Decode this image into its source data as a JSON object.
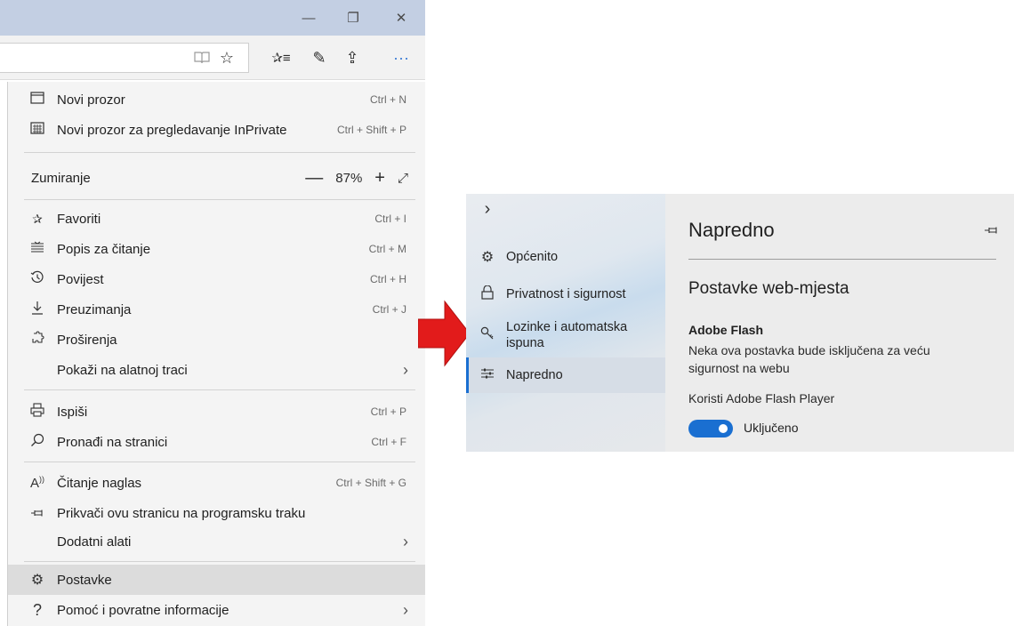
{
  "browser": {
    "window_controls": {
      "minimize": "—",
      "restore": "❐",
      "close": "✕"
    },
    "toolbar_icons": [
      "reading-view-icon",
      "favorite-star-icon",
      "favorites-list-icon",
      "web-note-icon",
      "share-icon",
      "more-icon"
    ],
    "toolbar_glyphs": {
      "reading": "📖",
      "star": "☆",
      "favorites": "✰≡",
      "note": "✎",
      "share": "⇪",
      "more": "···"
    },
    "menu": {
      "new_window": {
        "label": "Novi prozor",
        "shortcut": "Ctrl + N"
      },
      "new_inprivate": {
        "label": "Novi prozor za pregledavanje InPrivate",
        "shortcut": "Ctrl + Shift + P"
      },
      "zoom": {
        "label": "Zumiranje",
        "minus": "—",
        "value": "87%",
        "plus": "+",
        "fullscreen": "⤢"
      },
      "favorites": {
        "label": "Favoriti",
        "shortcut": "Ctrl + I"
      },
      "reading_list": {
        "label": "Popis za čitanje",
        "shortcut": "Ctrl + M"
      },
      "history": {
        "label": "Povijest",
        "shortcut": "Ctrl + H"
      },
      "downloads": {
        "label": "Preuzimanja",
        "shortcut": "Ctrl + J"
      },
      "extensions": {
        "label": "Proširenja"
      },
      "show_in_toolbar": {
        "label": "Pokaži na alatnoj traci",
        "chevron": "›"
      },
      "print": {
        "label": "Ispiši",
        "shortcut": "Ctrl + P"
      },
      "find": {
        "label": "Pronađi na stranici",
        "shortcut": "Ctrl + F"
      },
      "read_aloud": {
        "label": "Čitanje naglas",
        "shortcut": "Ctrl + Shift + G"
      },
      "pin_taskbar": {
        "label": "Prikvači ovu stranicu na programsku traku"
      },
      "more_tools": {
        "label": "Dodatni alati",
        "chevron": "›"
      },
      "settings": {
        "label": "Postavke"
      },
      "help": {
        "label": "Pomoć i povratne informacije",
        "chevron": "›"
      }
    }
  },
  "arrow": {
    "color": "#e21b1b"
  },
  "settings": {
    "expand_chevron": "›",
    "nav": [
      {
        "label": "Općenito",
        "icon": "gear-icon"
      },
      {
        "label": "Privatnost i sigurnost",
        "icon": "lock-icon"
      },
      {
        "label": "Lozinke i automatska ispuna",
        "icon": "key-icon"
      },
      {
        "label": "Napredno",
        "icon": "sliders-icon",
        "active": true
      }
    ],
    "panel_title": "Napredno",
    "section_title": "Postavke web-mjesta",
    "flash_title": "Adobe Flash",
    "flash_desc": "Neka ova postavka bude isključena za veću sigurnost na webu",
    "flash_toggle_label": "Koristi Adobe Flash Player",
    "flash_toggle_state": "Uključeno",
    "flash_enabled": true,
    "accent_color": "#1a6fd1"
  }
}
